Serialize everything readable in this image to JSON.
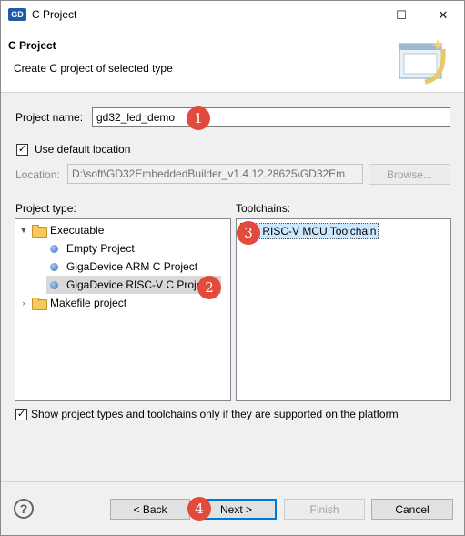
{
  "titlebar": {
    "icon_text": "GD",
    "title": "C Project",
    "maximize_glyph": "☐",
    "close_glyph": "✕"
  },
  "header": {
    "title": "C Project",
    "description": "Create C project of selected type"
  },
  "project_name": {
    "label": "Project name:",
    "value": "gd32_led_demo"
  },
  "location": {
    "use_default_label": "Use default location",
    "use_default_checked": true,
    "label": "Location:",
    "value": "D:\\soft\\GD32EmbeddedBuilder_v1.4.12.28625\\GD32Em",
    "browse_label": "Browse..."
  },
  "project_type": {
    "label": "Project type:",
    "items": [
      {
        "label": "Executable",
        "kind": "folder",
        "expanded": true
      },
      {
        "label": "Empty Project",
        "kind": "item"
      },
      {
        "label": "GigaDevice ARM C Project",
        "kind": "item"
      },
      {
        "label": "GigaDevice RISC-V C Project",
        "kind": "item",
        "selected": true
      },
      {
        "label": "Makefile project",
        "kind": "folder",
        "expanded": false
      }
    ]
  },
  "toolchains": {
    "label": "Toolchains:",
    "items": [
      "GD RISC-V MCU Toolchain"
    ]
  },
  "filter": {
    "label": "Show project types and toolchains only if they are supported on the platform",
    "checked": true
  },
  "buttons": {
    "help": "?",
    "back": "< Back",
    "next": "Next >",
    "finish": "Finish",
    "cancel": "Cancel"
  },
  "badges": [
    "1",
    "2",
    "3",
    "4"
  ],
  "colors": {
    "badge": "#e24a3b",
    "selection": "#d9d9d9",
    "accent": "#0078d7"
  }
}
